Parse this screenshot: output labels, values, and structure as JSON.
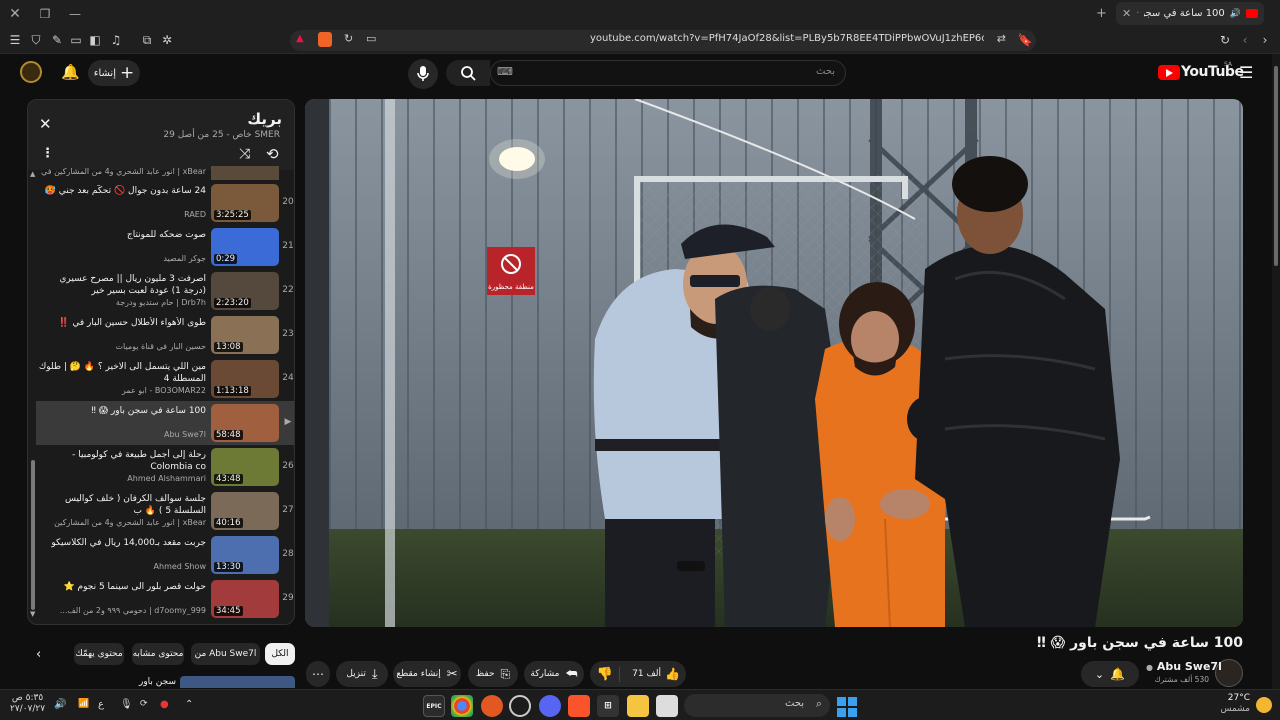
{
  "window": {
    "tab_title": "100 ساعة في سجن باور 😱‼",
    "tab_title_icon": "audio-icon"
  },
  "browser": {
    "url": "youtube.com/watch?v=PfH74JaOf28&list=PLBy5b7R8EE4TDiPPbwOVuJ1zhEP6cK7X-&index=25"
  },
  "youtube": {
    "logo_text": "YouTube",
    "logo_region": "SA",
    "search_placeholder": "بحث",
    "search_keyboard_icon": "⌨",
    "create_label": "إنشاء"
  },
  "playlist": {
    "title": "بريك",
    "meta": "SMER خاص - 25 من أصل 29",
    "items": [
      {
        "title": "انور عابد الشحري و4 من المشاركين في ...",
        "channel": "xBear",
        "partial": true
      },
      {
        "num": "20",
        "title": "24 ساعة بدون جوال 🚫 تحكّم بعد جني 🥵",
        "channel": "RAED",
        "dur": "3:25:25",
        "thumb": "#7a5a3a"
      },
      {
        "num": "21",
        "title": "صوت ضحكه للمونتاج",
        "channel": "جوكر المصيد",
        "dur": "0:29",
        "thumb": "#3b6bd6"
      },
      {
        "num": "22",
        "title": "اصرفت 3 مليون ريال || مصرح عسيري (درجة 1) عودة لعبت بسير خير",
        "channel": "Drb7h | حام ستديو ودرجة",
        "dur": "2:23:20",
        "thumb": "#55483c"
      },
      {
        "num": "23",
        "title": "طوى الأهواء الأطلال حسين البار في ‼️",
        "channel": "حسين البار في قناة يوميات",
        "dur": "13:08",
        "thumb": "#8a7055"
      },
      {
        "num": "24",
        "title": "مين اللي يتسمل الى الاخير ؟ 🔥 🤔 | طلوك المسطلة 4",
        "channel": "BO3OMAR22 - ابو عمر",
        "dur": "1:13:18",
        "thumb": "#6a4a35"
      },
      {
        "num": "▶",
        "title": "100 ساعة في سجن باور 😱 ‼",
        "channel": "Abu Swe7l",
        "dur": "58:48",
        "thumb": "#a06040",
        "active": true
      },
      {
        "num": "26",
        "title": "رحلة إلى أجمل طبيعة في كولومبيا - Colombia co",
        "channel": "Ahmed Alshammari",
        "dur": "43:48",
        "thumb": "#6d7a35"
      },
      {
        "num": "27",
        "title": "جلسة سوالف الكرفان ( خلف كواليس السلسلة 5 ) 🔥 ب",
        "channel": "xBear | انور عابد الشحري و4 من المشاركين",
        "dur": "40:16",
        "thumb": "#7c6a58"
      },
      {
        "num": "28",
        "title": "جربت مقعد بـ14,000 ريال في الكلاسيكو",
        "channel": "Ahmed Show",
        "dur": "13:30",
        "thumb": "#4d6fb0"
      },
      {
        "num": "29",
        "title": "حولت قصر بلور الى سينما 5 نجوم ⭐",
        "channel": "d7oomy_999 | دحومي ٩٩٩ و2 من الف...",
        "dur": "34:45",
        "thumb": "#a23b3b"
      }
    ]
  },
  "chips": [
    "الكل",
    "من Abu Swe7l",
    "محتوى مشابه",
    "محتوى يهمّك"
  ],
  "below_partial": "سجن باور",
  "video": {
    "title": "100 ساعة في سجن باور 😱 ‼",
    "channel": "Abu Swe7l",
    "subscribers": "530 ألف مشترك",
    "likes": "71 ألف",
    "share": "مشاركة",
    "save": "حفظ",
    "clip": "إنشاء مقطع",
    "download": "تنزيل",
    "sign_text": "منطقة محظورة"
  },
  "taskbar": {
    "search": "بحث",
    "weather_temp": "27°C",
    "weather_desc": "مشمس",
    "time": "٥:٣٥ ص",
    "date": "٢٧/٠٧/٢٧",
    "lang": "ع"
  },
  "colors": {
    "accent_red": "#ff0000",
    "background": "#0f0f0f",
    "orange_suit": "#e8731f"
  }
}
